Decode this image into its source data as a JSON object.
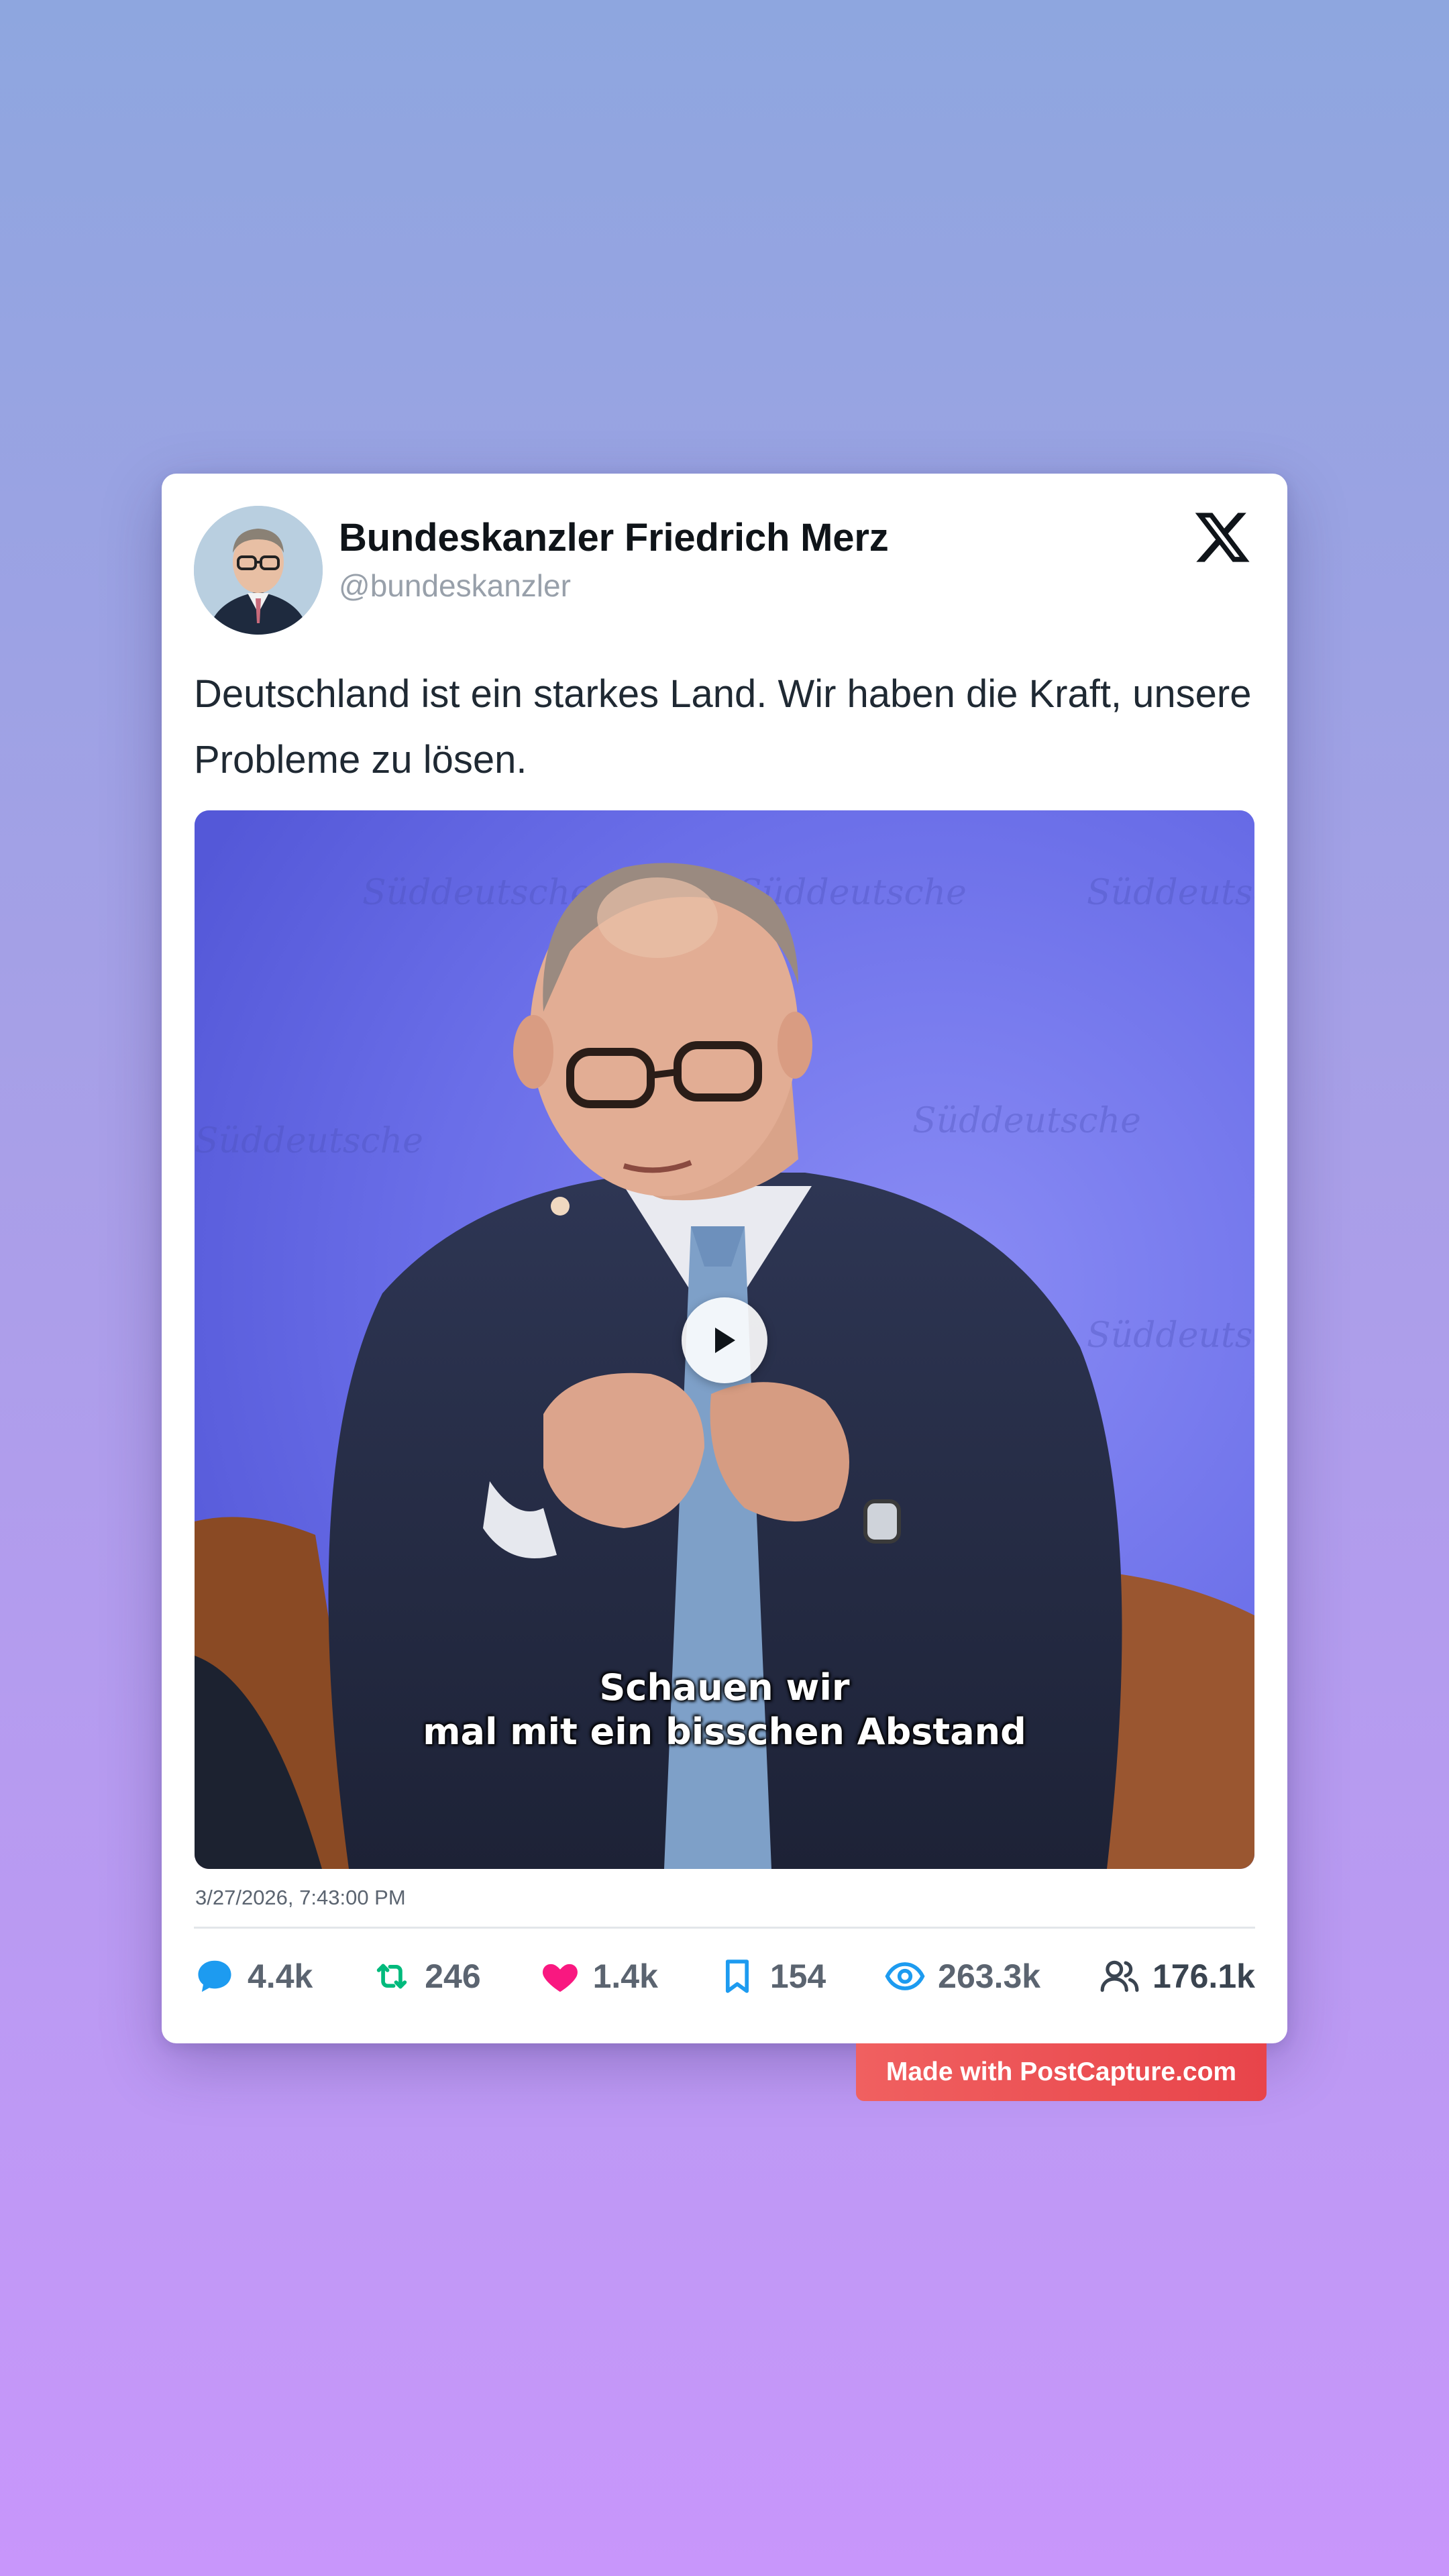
{
  "author": {
    "display_name": "Bundeskanzler Friedrich Merz",
    "handle": "@bundeskanzler"
  },
  "post": {
    "text": "Deutschland ist ein starkes Land. Wir haben die Kraft, unsere Probleme zu lösen.",
    "video_caption_line1": "Schauen wir",
    "video_caption_line2": "mal mit ein bisschen Abstand",
    "timestamp": "3/27/2026, 7:43:00 PM"
  },
  "stats": {
    "replies": "4.4k",
    "reposts": "246",
    "likes": "1.4k",
    "bookmarks": "154",
    "views": "263.3k",
    "followers": "176.1k"
  },
  "colors": {
    "reply": "#1d9bf0",
    "repost": "#00ba7c",
    "like": "#f91880",
    "bookmark": "#1d9bf0",
    "views": "#1d9bf0",
    "watermark_bg": "#e8444a"
  },
  "icons": [
    "x-logo-icon",
    "reply-icon",
    "repost-icon",
    "heart-icon",
    "bookmark-icon",
    "eye-icon",
    "followers-icon",
    "play-icon"
  ],
  "watermark": "Made with PostCapture.com"
}
